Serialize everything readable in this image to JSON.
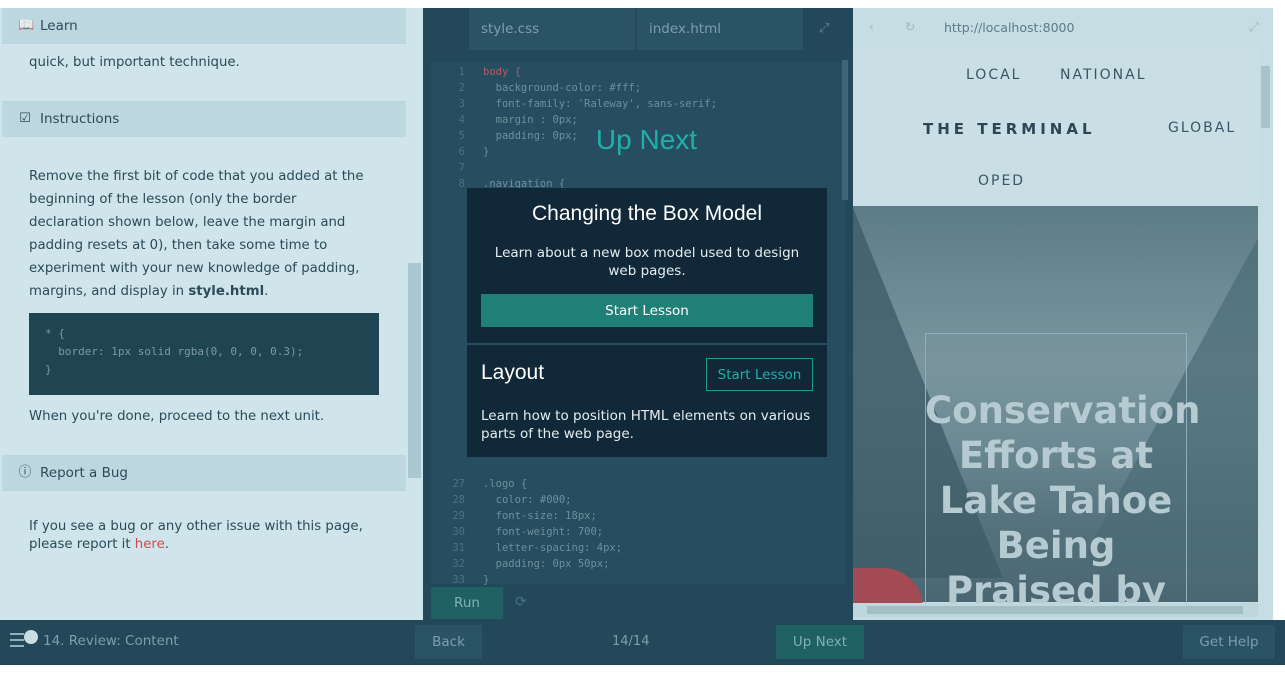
{
  "left_panel": {
    "learn_header": "Learn",
    "learn_text": "quick, but important technique.",
    "instructions_header": "Instructions",
    "instructions_text": "Remove the first bit of code that you added at the beginning of the lesson (only the border declaration shown below, leave the margin and padding resets at 0), then take some time to experiment with your new knowledge of padding, margins, and display in",
    "instructions_file": "style.html",
    "code_lines": [
      "* {",
      "  border: 1px solid rgba(0, 0, 0, 0.3);",
      "}"
    ],
    "done_text": "When you're done, proceed to the next unit.",
    "bug_header": "Report a Bug",
    "bug_text": "If you see a bug or any other issue with this page, please report it",
    "bug_link": "here"
  },
  "editor": {
    "tabs": [
      "style.css",
      "index.html"
    ],
    "run_label": "Run",
    "lines": [
      {
        "n": "1",
        "t": "body {"
      },
      {
        "n": "2",
        "t": "  background-color: #fff;"
      },
      {
        "n": "3",
        "t": "  font-family: 'Raleway', sans-serif;"
      },
      {
        "n": "4",
        "t": "  margin : 0px;"
      },
      {
        "n": "5",
        "t": "  padding: 0px;"
      },
      {
        "n": "6",
        "t": "}"
      },
      {
        "n": "7",
        "t": ""
      },
      {
        "n": "8",
        "t": ".navigation {"
      },
      {
        "n": "27",
        "t": ".logo {"
      },
      {
        "n": "28",
        "t": "  color: #000;"
      },
      {
        "n": "29",
        "t": "  font-size: 18px;"
      },
      {
        "n": "30",
        "t": "  font-weight: 700;"
      },
      {
        "n": "31",
        "t": "  letter-spacing: 4px;"
      },
      {
        "n": "32",
        "t": "  padding: 0px 50px;"
      },
      {
        "n": "33",
        "t": "}"
      }
    ]
  },
  "preview": {
    "url": "http://localhost:8000",
    "nav": {
      "local": "LOCAL",
      "national": "NATIONAL",
      "brand": "THE TERMINAL",
      "global": "GLOBAL",
      "oped": "OPED"
    },
    "hero_title": "Conservation Efforts at Lake Tahoe Being Praised by"
  },
  "modal": {
    "heading": "Up Next",
    "card1_title": "Changing the Box Model",
    "card1_desc": "Learn about a new box model used to design web pages.",
    "card1_button": "Start Lesson",
    "card2_title": "Layout",
    "card2_button": "Start Lesson",
    "card2_desc": "Learn how to position HTML elements on various parts of the web page."
  },
  "bottom_bar": {
    "unit": "14. Review: Content",
    "back": "Back",
    "page": "14/14",
    "up_next": "Up Next",
    "help": "Get Help"
  },
  "colors": {
    "accent": "#1fb0a8",
    "primary_button": "#1f8077",
    "modal_bg": "#102838",
    "link": "#d24b4b"
  }
}
